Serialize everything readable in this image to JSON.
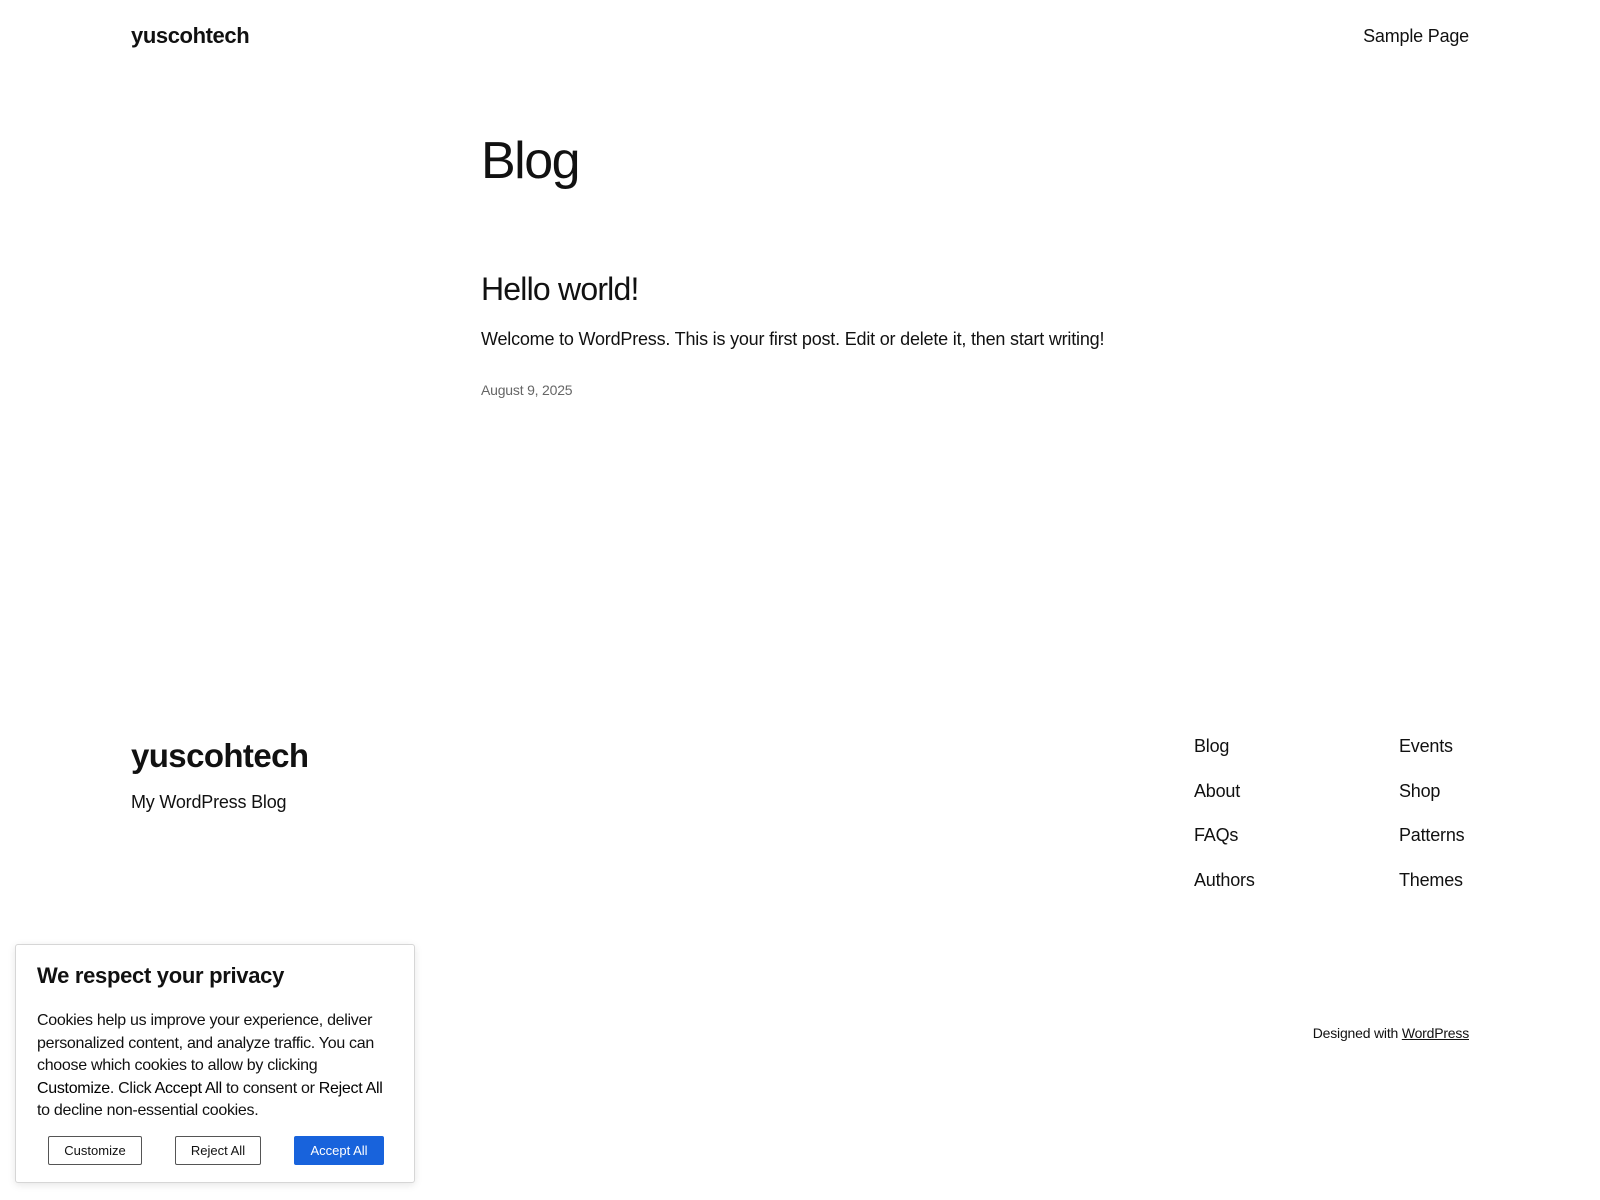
{
  "header": {
    "site_title": "yuscohtech",
    "nav": [
      {
        "label": "Sample Page"
      }
    ]
  },
  "main": {
    "page_title": "Blog",
    "posts": [
      {
        "title": "Hello world!",
        "excerpt": "Welcome to WordPress. This is your first post. Edit or delete it, then start writing!",
        "date": "August 9, 2025"
      }
    ]
  },
  "footer": {
    "site_title": "yuscohtech",
    "tagline": "My WordPress Blog",
    "nav_col1": [
      {
        "label": "Blog"
      },
      {
        "label": "About"
      },
      {
        "label": "FAQs"
      },
      {
        "label": "Authors"
      }
    ],
    "nav_col2": [
      {
        "label": "Events"
      },
      {
        "label": "Shop"
      },
      {
        "label": "Patterns"
      },
      {
        "label": "Themes"
      }
    ],
    "credit_prefix": "Designed with",
    "credit_link": "WordPress"
  },
  "cookie_banner": {
    "title": "We respect your privacy",
    "text_1": "Cookies help us improve your experience, deliver personalized content, and analyze traffic. You can choose which cookies to allow by clicking ",
    "text_customize": "Customize",
    "text_2": ". Click ",
    "text_accept": "Accept All",
    "text_3": " to consent or ",
    "text_reject": "Reject All",
    "text_4": " to decline non-essential cookies.",
    "customize_label": "Customize",
    "reject_label": "Reject All",
    "accept_label": "Accept All",
    "accept_color": "#1863dc"
  }
}
